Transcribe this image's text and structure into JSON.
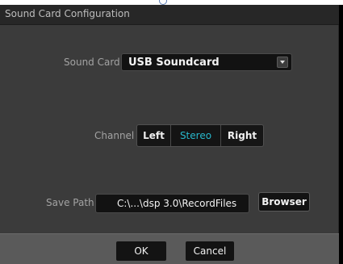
{
  "dialog": {
    "title": "Sound Card Configuration"
  },
  "sound_card": {
    "label": "Sound Card",
    "selected": "USB Soundcard"
  },
  "channel": {
    "label": "Channel",
    "options": [
      "Left",
      "Stereo",
      "Right"
    ],
    "selected": "Stereo"
  },
  "save_path": {
    "label": "Save Path",
    "value": "C:\\...\\dsp 3.0\\RecordFiles",
    "browse_label": "Browser"
  },
  "footer": {
    "ok_label": "OK",
    "cancel_label": "Cancel"
  },
  "colors": {
    "background": "#3b3b3b",
    "titlebar": "#272727",
    "footer": "#5a5a5a",
    "accent_selected": "#28b8cc"
  },
  "icons": {
    "dropdown": "chevron-down-icon"
  }
}
